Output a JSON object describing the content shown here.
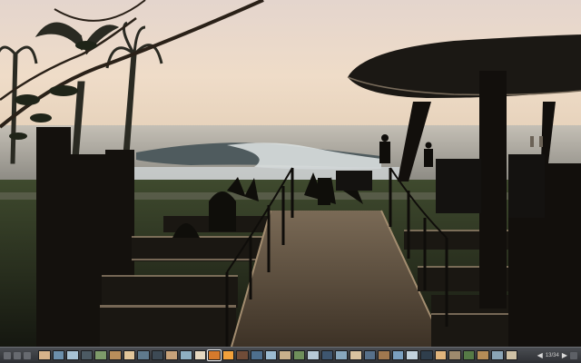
{
  "viewer": {
    "photo_subject": "beach-bar-at-sunset",
    "filmstrip": {
      "thumbnail_colors": [
        "#d6b38a",
        "#6c8fab",
        "#a8c2d4",
        "#4c5a63",
        "#7e9b6a",
        "#b98e5b",
        "#e1c59a",
        "#5f7a8d",
        "#3d4a55",
        "#c7a27a",
        "#8fb0c2",
        "#e6d8c0",
        "#d57a2c",
        "#f2a13b",
        "#704c38",
        "#4e6f8e",
        "#9bbbd1",
        "#c9b08c",
        "#6f8f5b",
        "#b7c9d6",
        "#3e5670",
        "#88a7bd",
        "#d9c3a0",
        "#57708a",
        "#a0784f",
        "#7ba0c0",
        "#c3d2dd",
        "#2f3e4c",
        "#e0b47c",
        "#9e8a6d",
        "#567a46",
        "#b58c57",
        "#8aa4b5",
        "#cfc1a5"
      ],
      "current_index": 12,
      "nav": {
        "prev_icon": "chevron-left-icon",
        "next_icon": "chevron-right-icon"
      },
      "counter_text": "13/34"
    },
    "colors": {
      "sky_top": "#e7d9cf",
      "sky_bottom": "#f2e2c8",
      "sea": "#b9b6ad",
      "wave": "#d9dfdf",
      "silhouette": "#1f1d18"
    }
  }
}
